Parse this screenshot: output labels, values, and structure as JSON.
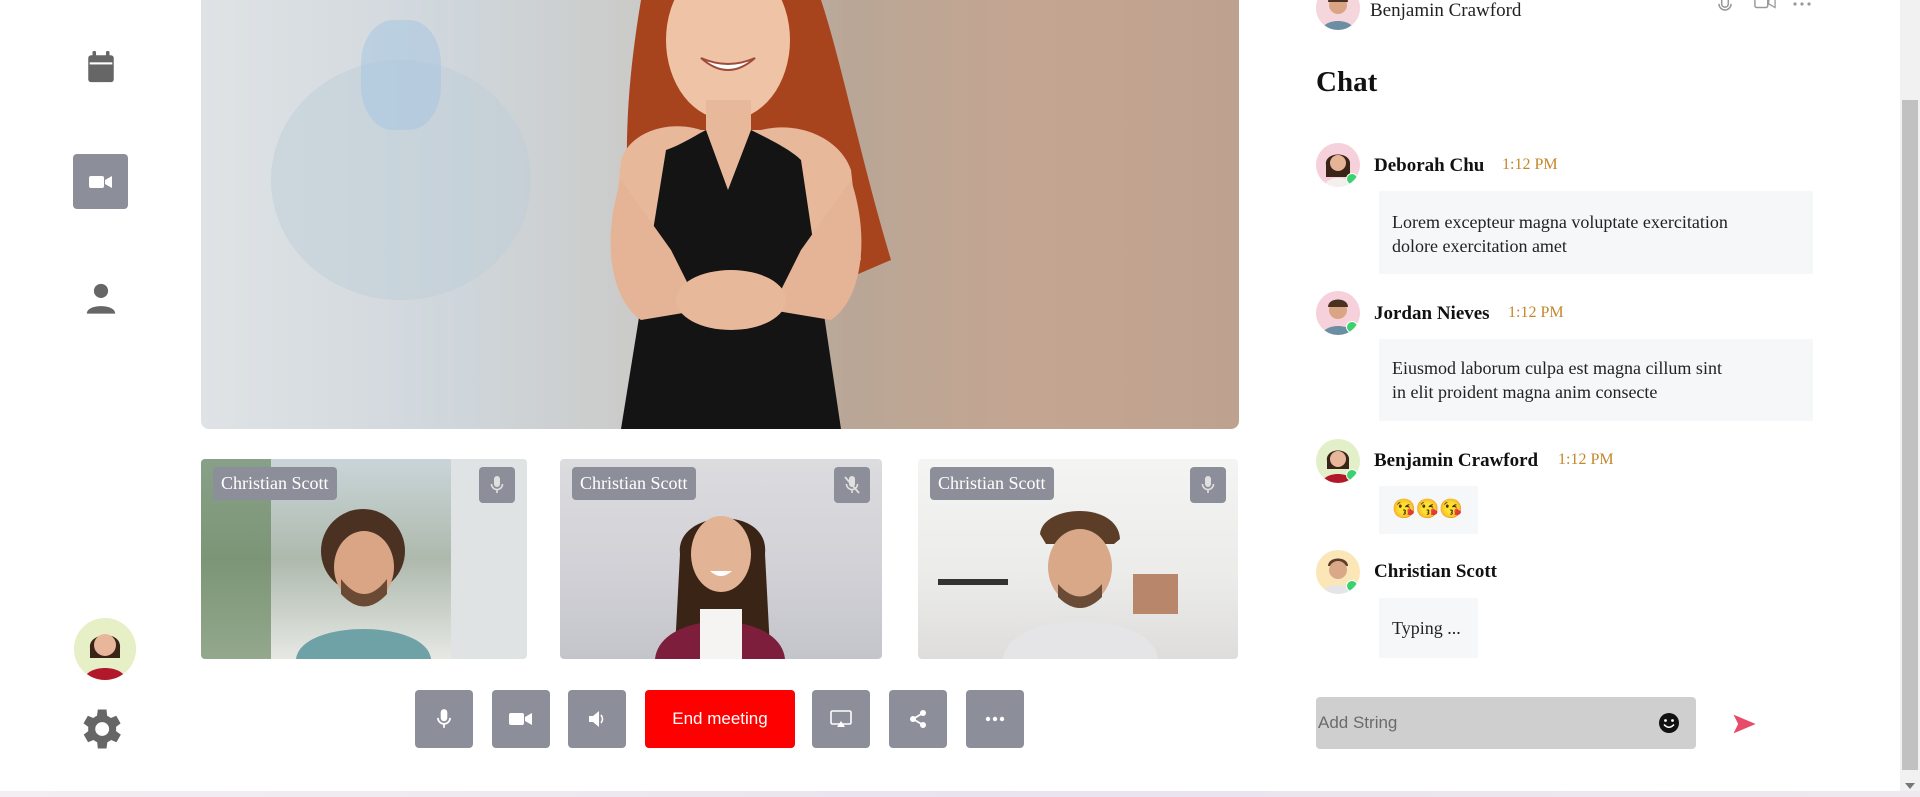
{
  "nav": {
    "items": [
      {
        "icon": "calendar-icon"
      },
      {
        "icon": "video-camera-icon",
        "active": true
      },
      {
        "icon": "person-icon"
      }
    ],
    "user_avatar": "avatar",
    "settings_icon": "gear-icon"
  },
  "thumbnails": [
    {
      "name": "Christian Scott",
      "mic": "mic-icon"
    },
    {
      "name": "Christian Scott",
      "mic": "mic-off-icon"
    },
    {
      "name": "Christian Scott",
      "mic": "mic-icon"
    }
  ],
  "controls": {
    "end_label": "End meeting"
  },
  "chat": {
    "header_name": "Benjamin Crawford",
    "title": "Chat",
    "messages": [
      {
        "name": "Deborah Chu",
        "time": "1:12 PM",
        "text_line1": "Lorem excepteur magna voluptate exercitation",
        "text_line2": "dolore exercitation amet"
      },
      {
        "name": "Jordan Nieves",
        "time": "1:12 PM",
        "text_line1": "Eiusmod laborum culpa est magna cillum sint",
        "text_line2": "in elit proident magna anim consecte"
      },
      {
        "name": "Benjamin Crawford",
        "time": "1:12 PM",
        "text": "😘😘😘"
      },
      {
        "name": "Christian Scott",
        "text": "Typing ..."
      }
    ],
    "input_placeholder": "Add String"
  },
  "colors": {
    "accent_gray": "#8c8f99",
    "end_red": "#ff0000",
    "time_color": "#c4862a",
    "send_pink": "#e84a6a",
    "online_green": "#3bd16f"
  }
}
